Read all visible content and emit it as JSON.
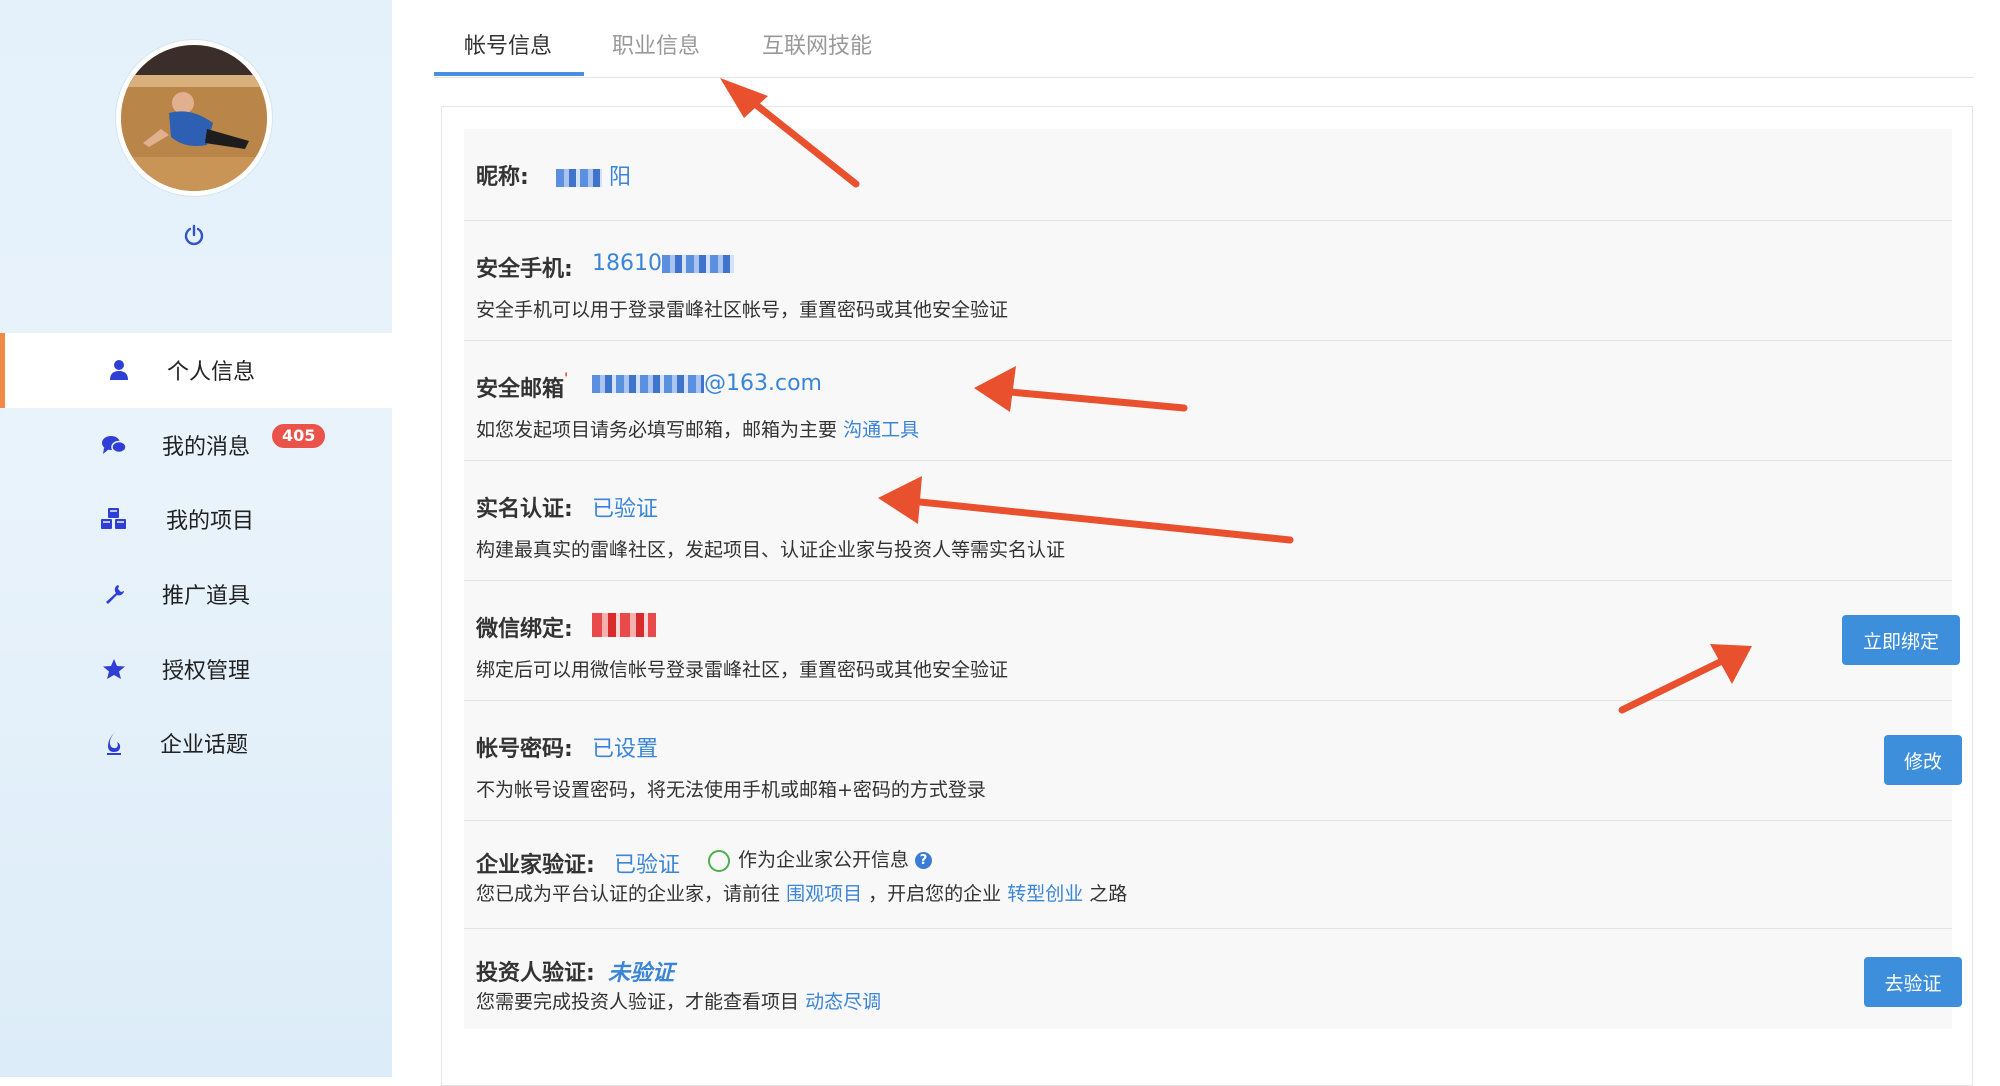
{
  "sidebar": {
    "menu": [
      {
        "label": "个人信息",
        "icon": "user-icon",
        "active": true
      },
      {
        "label": "我的消息",
        "icon": "chat-icon",
        "badge": "405"
      },
      {
        "label": "我的项目",
        "icon": "cubes-icon"
      },
      {
        "label": "推广道具",
        "icon": "wrench-icon"
      },
      {
        "label": "授权管理",
        "icon": "star-icon"
      },
      {
        "label": "企业话题",
        "icon": "flame-icon"
      }
    ]
  },
  "tabs": [
    "帐号信息",
    "职业信息",
    "互联网技能"
  ],
  "fields": {
    "nickname": {
      "label": "昵称:",
      "value": "阳"
    },
    "phone": {
      "label": "安全手机:",
      "value": "18610",
      "desc": "安全手机可以用于登录雷峰社区帐号，重置密码或其他安全验证"
    },
    "email": {
      "label": "安全邮箱",
      "value": "@163.com",
      "desc": "如您发起项目请务必填写邮箱，邮箱为主要",
      "desc_link": "沟通工具"
    },
    "realname": {
      "label": "实名认证:",
      "value": "已验证",
      "desc": "构建最真实的雷峰社区，发起项目、认证企业家与投资人等需实名认证"
    },
    "wechat": {
      "label": "微信绑定:",
      "desc": "绑定后可以用微信帐号登录雷峰社区，重置密码或其他安全验证",
      "button": "立即绑定"
    },
    "password": {
      "label": "帐号密码:",
      "value": "已设置",
      "desc": "不为帐号设置密码，将无法使用手机或邮箱+密码的方式登录",
      "button": "修改"
    },
    "entrepreneur": {
      "label": "企业家验证:",
      "value": "已验证",
      "public_option": "作为企业家公开信息",
      "desc_1": "您已成为平台认证的企业家，请前往",
      "link_1": "围观项目",
      "desc_2": "，开启您的企业",
      "link_2": "转型创业",
      "desc_3": "之路"
    },
    "investor": {
      "label": "投资人验证:",
      "value": "未验证",
      "desc": "您需要完成投资人验证，才能查看项目",
      "desc_link": "动态尽调",
      "button": "去验证"
    }
  },
  "colors": {
    "accent": "#3d8fdc",
    "link": "#3a85d6",
    "annotation_arrow": "#e8502e",
    "badge": "#e9534a",
    "unverified": "#e8331f"
  }
}
